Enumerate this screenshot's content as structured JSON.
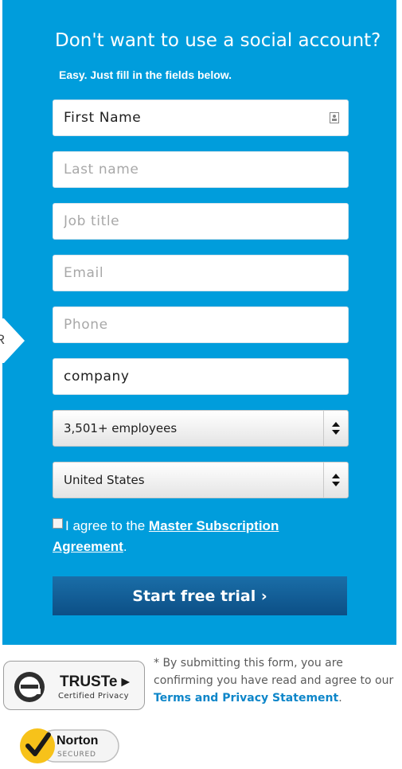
{
  "form": {
    "title": "Don't want to use a social account?",
    "subtitle": "Easy. Just fill in the fields below.",
    "separator_text": "R",
    "fields": {
      "first_name": {
        "value": "First Name",
        "placeholder": "First Name"
      },
      "last_name": {
        "value": "",
        "placeholder": "Last name"
      },
      "job_title": {
        "value": "",
        "placeholder": "Job title"
      },
      "email": {
        "value": "",
        "placeholder": "Email"
      },
      "phone": {
        "value": "",
        "placeholder": "Phone"
      },
      "company": {
        "value": "company",
        "placeholder": "company"
      }
    },
    "employees_select": {
      "selected": "3,501+ employees"
    },
    "country_select": {
      "selected": "United States"
    },
    "agreement": {
      "prefix": "I agree to the ",
      "link_text": "Master Subscription Agreement",
      "suffix": ".",
      "checked": false
    },
    "submit_label": "Start free trial ›"
  },
  "footer": {
    "truste": {
      "brand": "TRUSTe ▸",
      "tagline": "Certified Privacy"
    },
    "disclaimer": {
      "text": "* By submitting this form, you are confirming you have read and agree to our ",
      "link_text": "Terms and Privacy Statement",
      "suffix": "."
    },
    "norton": {
      "brand": "Norton",
      "tagline": "SECURED"
    }
  },
  "colors": {
    "panel": "#009ddc",
    "button": "#0c4f86",
    "link": "#0e86c9",
    "norton_yellow": "#f7c21a"
  }
}
